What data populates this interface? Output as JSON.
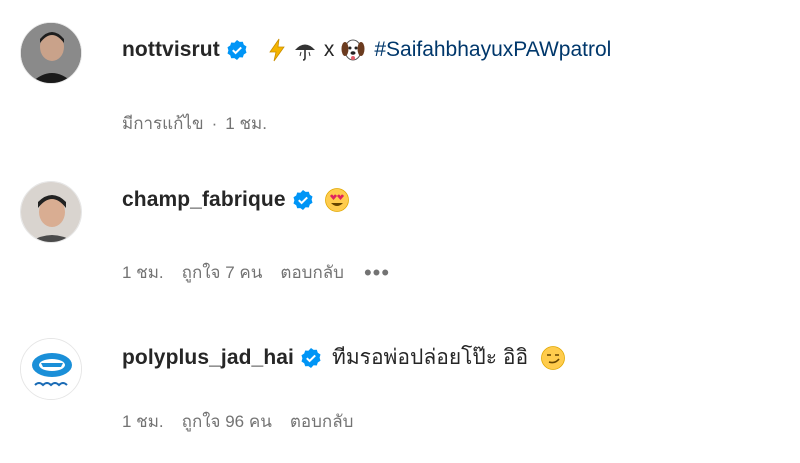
{
  "comments": [
    {
      "username": "nottvisrut",
      "verified": true,
      "emoji_left": "lightning-icon",
      "emoji_mid": "umbrella-icon",
      "x": "x",
      "emoji_dog": "dog-face-icon",
      "hashtag": "#SaifahbhayuxPAWpatrol",
      "meta_edited": "มีการแก้ไข",
      "meta_dot": "·",
      "meta_time": "1 ชม."
    },
    {
      "username": "champ_fabrique",
      "verified": true,
      "emoji": "heart-eyes-icon",
      "meta_time": "1 ชม.",
      "meta_likes": "ถูกใจ 7 คน",
      "meta_reply": "ตอบกลับ",
      "meta_more": "•••"
    },
    {
      "username": "polyplus_jad_hai",
      "verified": true,
      "text": "ทีมรอพ่อปล่อยโป๊ะ อิอิ",
      "emoji": "smirk-face-icon",
      "meta_time": "1 ชม.",
      "meta_likes": "ถูกใจ 96 คน",
      "meta_reply": "ตอบกลับ"
    }
  ],
  "colors": {
    "text": "#262626",
    "meta": "#737373",
    "hashtag": "#00376b",
    "verified": "#0095f6"
  }
}
